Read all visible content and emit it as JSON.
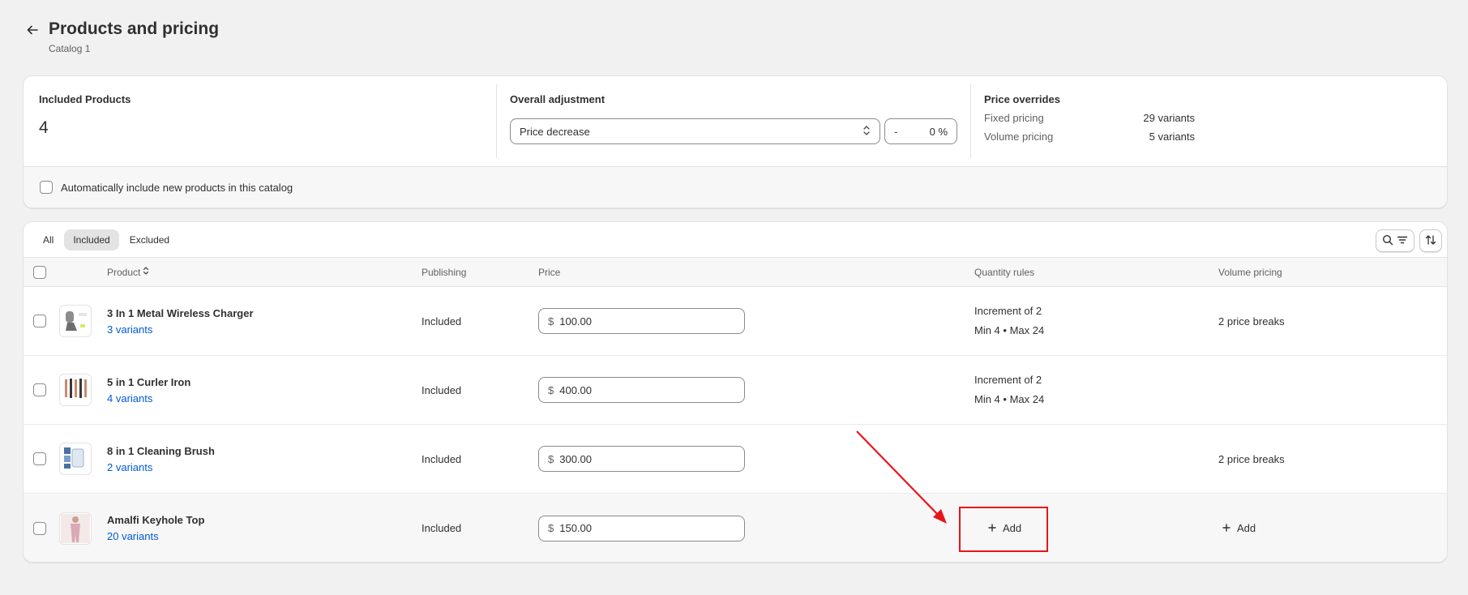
{
  "header": {
    "title": "Products and pricing",
    "subtitle": "Catalog 1"
  },
  "summary": {
    "included_label": "Included Products",
    "included_count": "4",
    "adjustment_label": "Overall adjustment",
    "adjustment_select": "Price decrease",
    "adjustment_sign": "-",
    "adjustment_value": "0",
    "adjustment_unit": "%",
    "overrides_label": "Price overrides",
    "overrides": [
      {
        "name": "Fixed pricing",
        "value": "29 variants"
      },
      {
        "name": "Volume pricing",
        "value": "5 variants"
      }
    ],
    "auto_include_label": "Automatically include new products in this catalog"
  },
  "tabs": [
    {
      "label": "All",
      "active": false
    },
    {
      "label": "Included",
      "active": true
    },
    {
      "label": "Excluded",
      "active": false
    }
  ],
  "table": {
    "headers": {
      "product": "Product",
      "publishing": "Publishing",
      "price": "Price",
      "quantity_rules": "Quantity rules",
      "volume_pricing": "Volume pricing"
    },
    "rows": [
      {
        "name": "3 In 1 Metal Wireless Charger",
        "variants": "3 variants",
        "publishing": "Included",
        "currency": "$",
        "price": "100.00",
        "qty_line1": "Increment of 2",
        "qty_line2": "Min 4 • Max 24",
        "volume": "2 price breaks"
      },
      {
        "name": "5 in 1 Curler Iron",
        "variants": "4 variants",
        "publishing": "Included",
        "currency": "$",
        "price": "400.00",
        "qty_line1": "Increment of 2",
        "qty_line2": "Min 4 • Max 24",
        "volume": ""
      },
      {
        "name": "8 in 1 Cleaning Brush",
        "variants": "2 variants",
        "publishing": "Included",
        "currency": "$",
        "price": "300.00",
        "qty_line1": "",
        "qty_line2": "",
        "volume": "2 price breaks"
      },
      {
        "name": "Amalfi Keyhole Top",
        "variants": "20 variants",
        "publishing": "Included",
        "currency": "$",
        "price": "150.00",
        "qty_add": "Add",
        "volume_add": "Add"
      }
    ]
  },
  "colors": {
    "link": "#005bd3",
    "annotation": "#e8151b",
    "background": "#f1f1f1"
  }
}
